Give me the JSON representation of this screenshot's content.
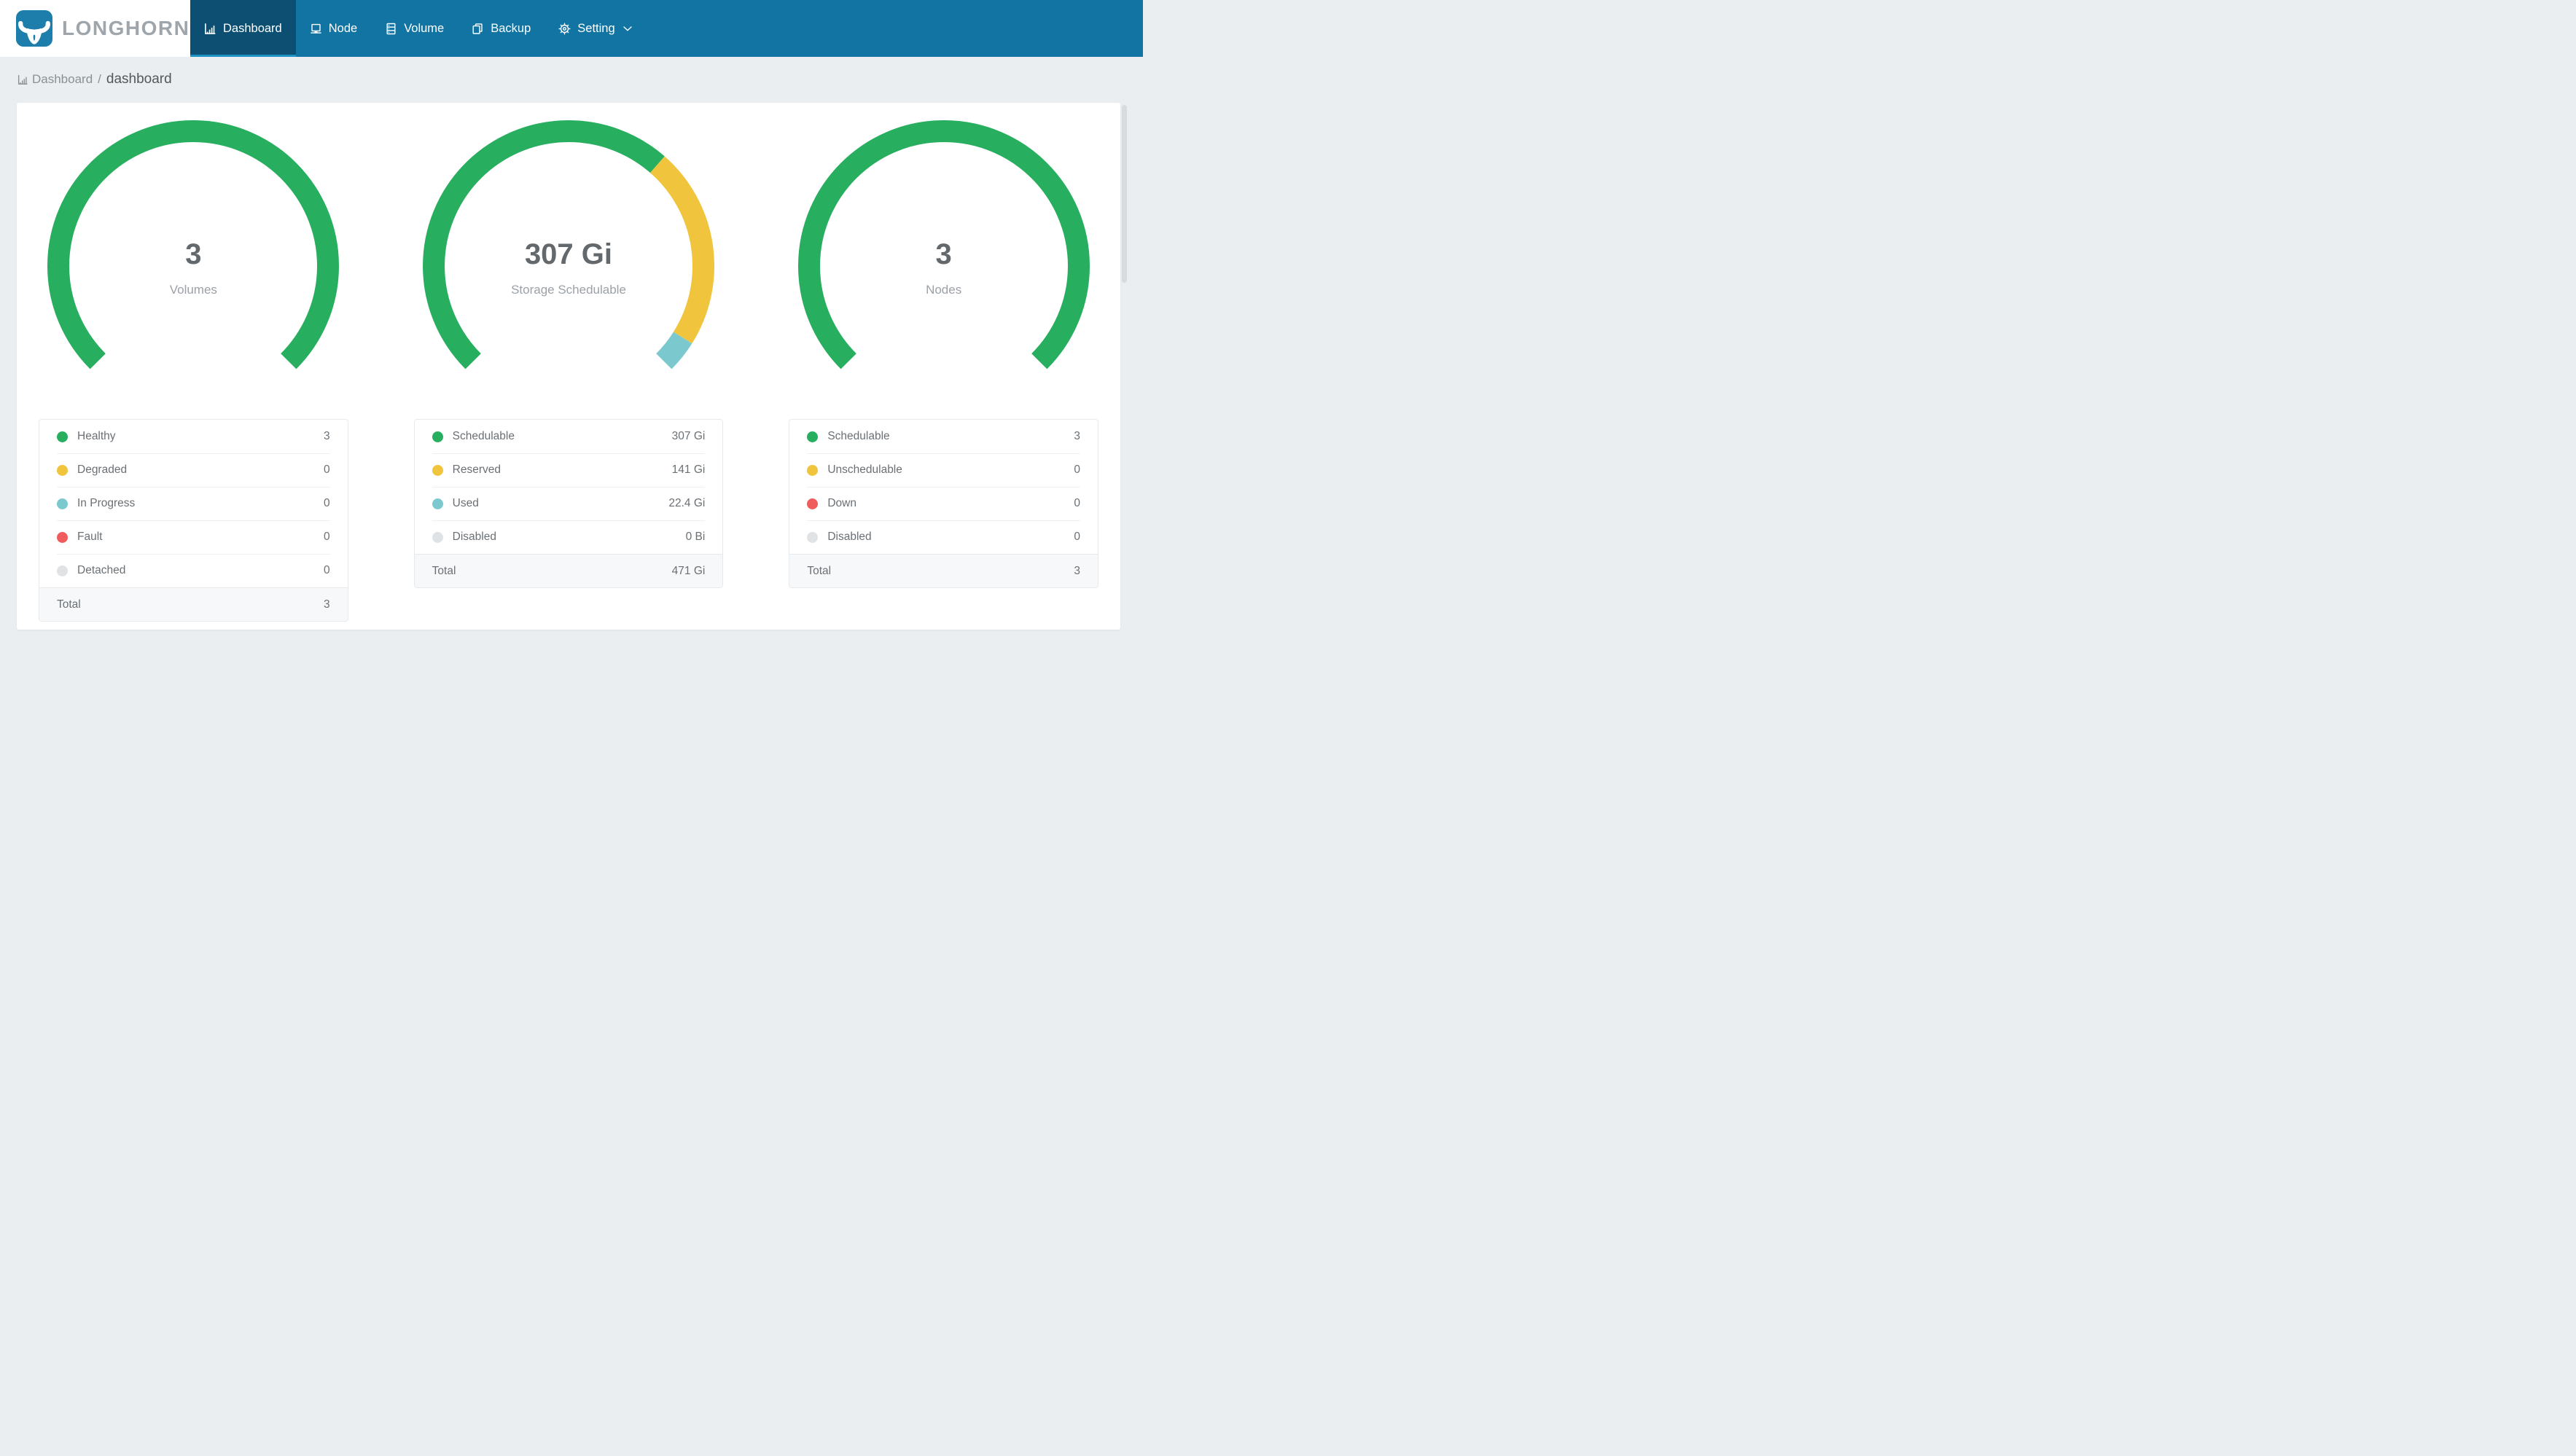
{
  "header": {
    "brand": "LONGHORN",
    "nav_items": [
      {
        "label": "Dashboard",
        "icon": "bar-chart-icon",
        "active": true
      },
      {
        "label": "Node",
        "icon": "laptop-icon",
        "active": false
      },
      {
        "label": "Volume",
        "icon": "database-icon",
        "active": false
      },
      {
        "label": "Backup",
        "icon": "copy-icon",
        "active": false
      },
      {
        "label": "Setting",
        "icon": "gear-icon",
        "active": false,
        "has_dropdown": true
      }
    ]
  },
  "breadcrumb": {
    "root": "Dashboard",
    "separator": "/",
    "current": "dashboard"
  },
  "palette": {
    "green": "#27AE5E",
    "yellow": "#F0C53D",
    "teal": "#7BC9CE",
    "red": "#F05C5C",
    "gray": "#DFE3E6",
    "navbar": "#1274A3",
    "active_tab": "#0C4F73",
    "tab_underline": "#1D93C5",
    "logo_blue": "#1E7EAB"
  },
  "chart_data": [
    {
      "type": "gauge",
      "center_value": "3",
      "center_label": "Volumes",
      "start_angle_deg": -135,
      "arc_span_deg": 270,
      "segments": [
        {
          "label": "Healthy",
          "value": 3,
          "display": "3",
          "color_key": "green"
        },
        {
          "label": "Degraded",
          "value": 0,
          "display": "0",
          "color_key": "yellow"
        },
        {
          "label": "In Progress",
          "value": 0,
          "display": "0",
          "color_key": "teal"
        },
        {
          "label": "Fault",
          "value": 0,
          "display": "0",
          "color_key": "red"
        },
        {
          "label": "Detached",
          "value": 0,
          "display": "0",
          "color_key": "gray"
        }
      ],
      "total": {
        "label": "Total",
        "value": 3,
        "display": "3"
      }
    },
    {
      "type": "gauge",
      "center_value": "307 Gi",
      "center_label": "Storage Schedulable",
      "start_angle_deg": -135,
      "arc_span_deg": 270,
      "segments": [
        {
          "label": "Schedulable",
          "value": 307,
          "display": "307 Gi",
          "color_key": "green"
        },
        {
          "label": "Reserved",
          "value": 141,
          "display": "141 Gi",
          "color_key": "yellow"
        },
        {
          "label": "Used",
          "value": 22.4,
          "display": "22.4 Gi",
          "color_key": "teal"
        },
        {
          "label": "Disabled",
          "value": 0,
          "display": "0 Bi",
          "color_key": "gray"
        }
      ],
      "total": {
        "label": "Total",
        "value": 471,
        "display": "471 Gi"
      }
    },
    {
      "type": "gauge",
      "center_value": "3",
      "center_label": "Nodes",
      "start_angle_deg": -135,
      "arc_span_deg": 270,
      "segments": [
        {
          "label": "Schedulable",
          "value": 3,
          "display": "3",
          "color_key": "green"
        },
        {
          "label": "Unschedulable",
          "value": 0,
          "display": "0",
          "color_key": "yellow"
        },
        {
          "label": "Down",
          "value": 0,
          "display": "0",
          "color_key": "red"
        },
        {
          "label": "Disabled",
          "value": 0,
          "display": "0",
          "color_key": "gray"
        }
      ],
      "total": {
        "label": "Total",
        "value": 3,
        "display": "3"
      }
    }
  ]
}
